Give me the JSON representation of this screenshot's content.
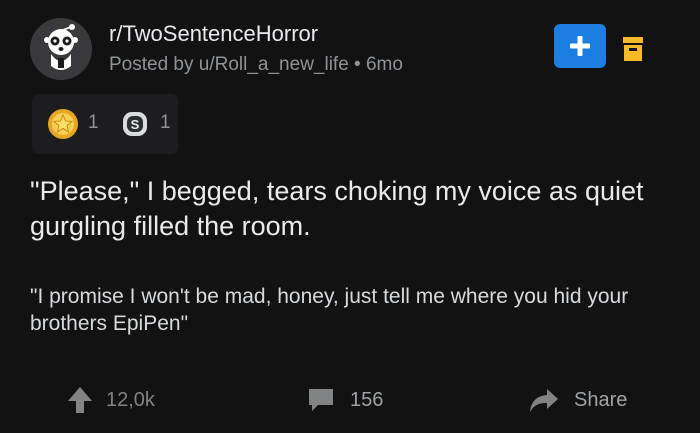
{
  "post": {
    "subreddit": "r/TwoSentenceHorror",
    "posted_by": "Posted by u/Roll_a_new_life • 6mo",
    "title": "\"Please,\" I begged, tears choking my voice as quiet gurgling filled the room.",
    "body": "\"I promise I won't be mad, honey, just tell me where you hid your brothers EpiPen\""
  },
  "awards": [
    {
      "icon": "star-award-icon",
      "count": "1"
    },
    {
      "icon": "silver-award-icon",
      "count": "1"
    }
  ],
  "actions": {
    "upvotes": "12,0k",
    "comments": "156",
    "share": "Share"
  },
  "icons": {
    "join": "plus-icon",
    "save": "archive-icon"
  },
  "colors": {
    "background": "#121213",
    "accent": "#1b7ee0",
    "archive": "#f7b928",
    "muted_text": "#8f9396"
  }
}
